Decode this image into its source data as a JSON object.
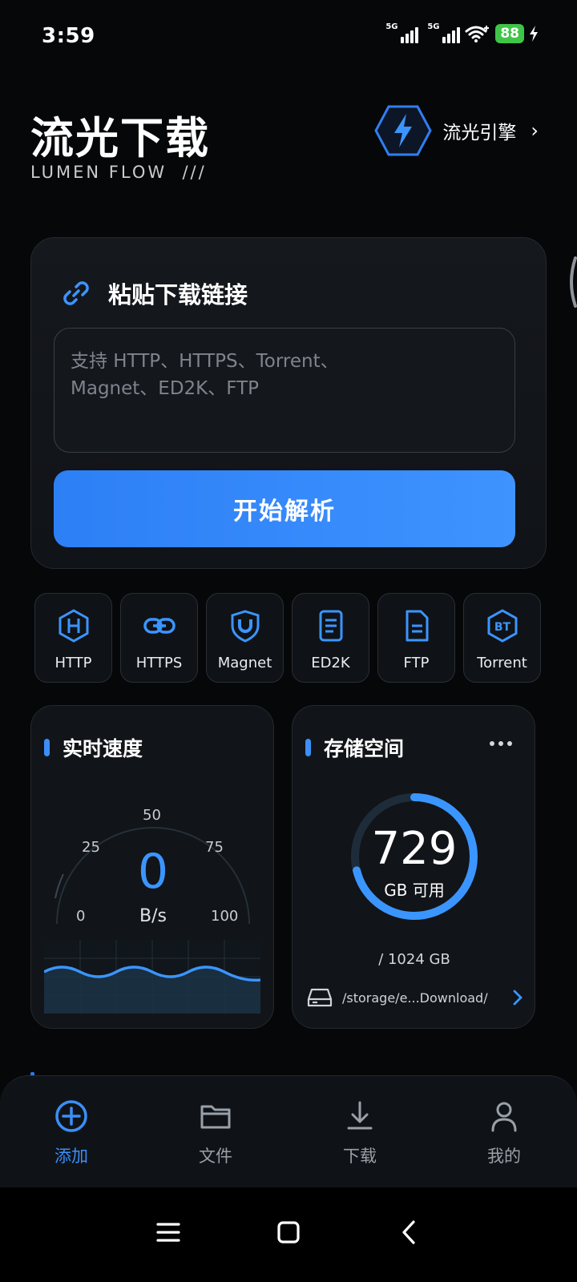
{
  "status_bar": {
    "time": "3:59",
    "signal_1_label": "5G",
    "signal_2_label": "5G",
    "battery": "88"
  },
  "header": {
    "title": "流光下载",
    "subtitle": "LUMEN FLOW  ///",
    "engine_label": "流光引擎",
    "engine_chevron": "›"
  },
  "paste_card": {
    "title": "粘贴下载链接",
    "input_placeholder": "支持 HTTP、HTTPS、Torrent、\nMagnet、ED2K、FTP",
    "parse_button": "开始解析"
  },
  "protocols": [
    {
      "label": "HTTP",
      "icon": "hexagon-h-icon"
    },
    {
      "label": "HTTPS",
      "icon": "chain-link-icon"
    },
    {
      "label": "Magnet",
      "icon": "magnet-shield-icon"
    },
    {
      "label": "ED2K",
      "icon": "document-icon"
    },
    {
      "label": "FTP",
      "icon": "file-icon"
    },
    {
      "label": "Torrent",
      "icon": "bt-hexagon-icon",
      "icon_text": "BT"
    }
  ],
  "speed_card": {
    "title": "实时速度",
    "value": "0",
    "unit": "B/s",
    "gauge_ticks": [
      "0",
      "25",
      "50",
      "75",
      "100"
    ]
  },
  "storage_card": {
    "title": "存储空间",
    "available": "729",
    "available_unit": "GB 可用",
    "total": "/ 1024 GB",
    "available_fraction": 0.712,
    "path": "/storage/e...Download/"
  },
  "bottom_nav": [
    {
      "label": "添加",
      "icon": "add-circle-icon",
      "active": true
    },
    {
      "label": "文件",
      "icon": "folder-icon",
      "active": false
    },
    {
      "label": "下载",
      "icon": "download-icon",
      "active": false
    },
    {
      "label": "我的",
      "icon": "profile-icon",
      "active": false
    }
  ],
  "colors": {
    "accent": "#3b8ff8",
    "background": "#060708",
    "card": "#111418",
    "battery": "#3ec548"
  }
}
